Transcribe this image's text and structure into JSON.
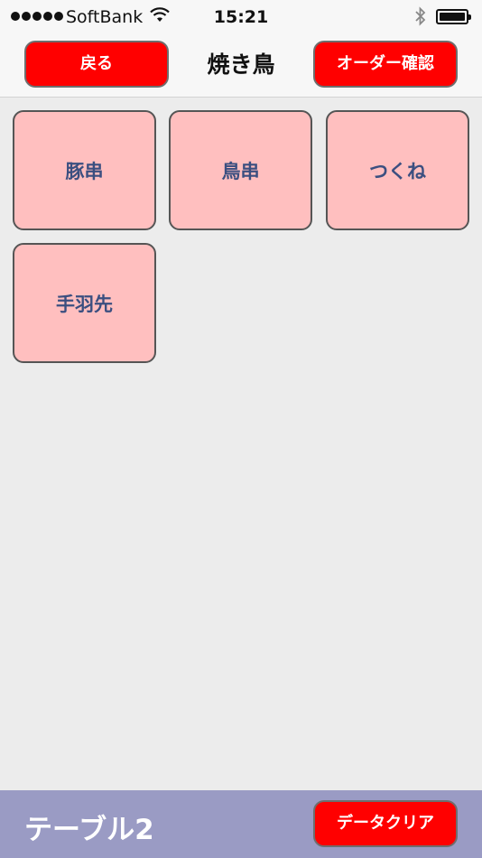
{
  "status_bar": {
    "carrier": "SoftBank",
    "time": "15:21",
    "wifi_icon": "wifi-icon",
    "bluetooth_icon": "bluetooth-icon",
    "battery_icon": "battery-icon",
    "battery_level": 1.0
  },
  "nav": {
    "back_label": "戻る",
    "title": "焼き鳥",
    "confirm_label": "オーダー確認"
  },
  "menu": {
    "items": [
      {
        "label": "豚串"
      },
      {
        "label": "鳥串"
      },
      {
        "label": "つくね"
      },
      {
        "label": "手羽先"
      }
    ]
  },
  "bottom": {
    "table_label": "テーブル2",
    "clear_label": "データクリア"
  },
  "colors": {
    "button_red": "#ff0000",
    "tile_pink": "#ffbfbf",
    "tile_text": "#3b4f80",
    "bottom_bar": "#9a9bc4"
  }
}
